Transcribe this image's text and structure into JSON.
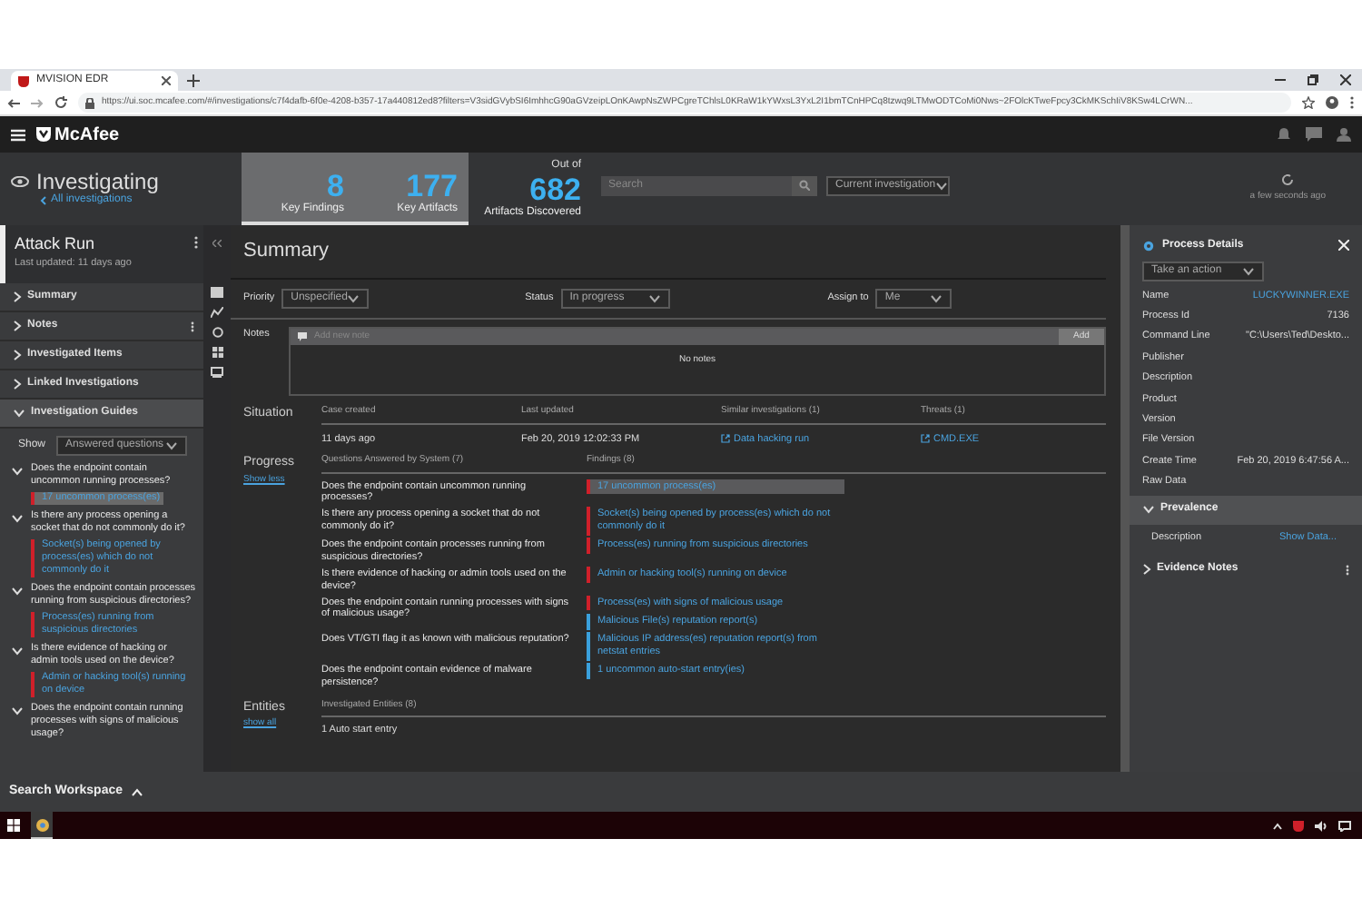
{
  "browser": {
    "tab_title": "MVISION EDR",
    "url": "https://ui.soc.mcafee.com/#/investigations/c7f4dafb-6f0e-4208-b357-17a440812ed8?filters=V3sidGVybSI6ImhhcG90aGVzeipLOnKAwpNsZWPCgreTChlsL0KRaW1kYWxsL3YxL2I1bmTCnHPCq8tzwq9LTMwODTCoMi0Nws~2FOlcKTweFpcy3CkMKSchIiV8KSw4LCrWN..."
  },
  "app": {
    "brand": "McAfee"
  },
  "header": {
    "title": "Investigating",
    "back_link": "All investigations",
    "stats": [
      {
        "value": "8",
        "label": "Key Findings"
      },
      {
        "value": "177",
        "label": "Key Artifacts"
      }
    ],
    "discovered": {
      "caption": "Out of",
      "value": "682",
      "label": "Artifacts Discovered"
    },
    "search": {
      "placeholder": "Search"
    },
    "scope": "Current investigation",
    "refreshed": "a few seconds ago"
  },
  "case": {
    "title": "Attack Run",
    "updated": "Last updated: 11 days ago"
  },
  "sections": [
    {
      "label": "Summary",
      "expanded": false
    },
    {
      "label": "Notes",
      "expanded": false
    },
    {
      "label": "Investigated Items",
      "expanded": false
    },
    {
      "label": "Linked Investigations",
      "expanded": false
    },
    {
      "label": "Investigation Guides",
      "expanded": true
    }
  ],
  "guide_filter": {
    "label": "Show",
    "value": "Answered questions"
  },
  "guides": [
    {
      "question": "Does the endpoint contain uncommon running processes?",
      "expanded": true,
      "finding": "17 uncommon process(es)",
      "selected": true
    },
    {
      "question": "Is there any process opening a socket that do not commonly do it?",
      "expanded": true,
      "finding": "Socket(s) being opened by process(es) which do not commonly do it",
      "selected": false
    },
    {
      "question": "Does the endpoint contain processes running from suspicious directories?",
      "expanded": true,
      "finding": "Process(es) running from suspicious directories",
      "selected": false
    },
    {
      "question": "Is there evidence of hacking or admin tools used on the device?",
      "expanded": true,
      "finding": "Admin or hacking tool(s) running on device",
      "selected": false
    },
    {
      "question": "Does the endpoint contain running processes with signs of malicious usage?",
      "expanded": true
    }
  ],
  "summary": {
    "title": "Summary",
    "fields": [
      {
        "label": "Priority",
        "value": "Unspecified"
      },
      {
        "label": "Status",
        "value": "In progress"
      },
      {
        "label": "Assign to",
        "value": "Me"
      }
    ],
    "notes": {
      "label": "Notes",
      "placeholder": "Add new note",
      "button": "Add",
      "empty": "No notes"
    }
  },
  "situation": {
    "label": "Situation",
    "columns": [
      {
        "heading": "Case created",
        "value": "11 days ago",
        "kind": "text"
      },
      {
        "heading": "Last updated",
        "value": "Feb 20, 2019 12:02:33 PM",
        "kind": "text"
      },
      {
        "heading": "Similar investigations (1)",
        "value": "Data hacking run",
        "kind": "link"
      },
      {
        "heading": "Threats (1)",
        "value": "CMD.EXE",
        "kind": "link"
      }
    ]
  },
  "progress": {
    "label": "Progress",
    "toggle": "Show less",
    "questions_heading": "Questions Answered by System (7)",
    "findings_heading": "Findings (8)",
    "rows": [
      {
        "question": "Does the endpoint contain uncommon running processes?",
        "findings": [
          {
            "text": "17 uncommon process(es)",
            "color": "#d0202a",
            "selected": true
          }
        ]
      },
      {
        "question": "Is there any process opening a socket that do not commonly do it?",
        "findings": [
          {
            "text": "Socket(s) being opened by process(es) which do not commonly do it",
            "color": "#d0202a",
            "selected": false
          }
        ]
      },
      {
        "question": "Does the endpoint contain processes running from suspicious directories?",
        "findings": [
          {
            "text": "Process(es) running from suspicious directories",
            "color": "#d0202a",
            "selected": false
          }
        ]
      },
      {
        "question": "Is there evidence of hacking or admin tools used on the device?",
        "findings": [
          {
            "text": "Admin or hacking tool(s) running on device",
            "color": "#d0202a",
            "selected": false
          }
        ]
      },
      {
        "question": "Does the endpoint contain running processes with signs of malicious usage?",
        "findings": [
          {
            "text": "Process(es) with signs of malicious usage",
            "color": "#d0202a",
            "selected": false
          },
          {
            "text": "Malicious File(s) reputation report(s)",
            "color": "#3aa0dc",
            "selected": false
          }
        ]
      },
      {
        "question": "Does VT/GTI flag it as known with malicious reputation?",
        "findings": [
          {
            "text": "Malicious IP address(es) reputation report(s) from netstat entries",
            "color": "#3aa0dc",
            "selected": false
          }
        ]
      },
      {
        "question": "Does the endpoint contain evidence of malware persistence?",
        "findings": [
          {
            "text": "1 uncommon auto-start entry(ies)",
            "color": "#3aa0dc",
            "selected": false
          }
        ]
      }
    ]
  },
  "entities": {
    "label": "Entities",
    "toggle": "show all",
    "heading": "Investigated Entities (8)",
    "first": "1 Auto start entry"
  },
  "details": {
    "title": "Process Details",
    "action": "Take an action",
    "properties": [
      {
        "label": "Name",
        "value": "LUCKYWINNER.EXE",
        "kind": "link"
      },
      {
        "label": "Process Id",
        "value": "7136",
        "kind": "text"
      },
      {
        "label": "Command Line",
        "value": "\"C:\\Users\\Ted\\Deskto...",
        "kind": "text"
      },
      {
        "label": "Publisher"
      },
      {
        "label": "Description"
      },
      {
        "label": "Product"
      },
      {
        "label": "Version"
      },
      {
        "label": "File Version"
      },
      {
        "label": "Create Time",
        "value": "Feb 20, 2019 6:47:56 A...",
        "kind": "text"
      },
      {
        "label": "Raw Data"
      }
    ],
    "sections": [
      {
        "label": "Prevalence",
        "expanded": true,
        "rows": [
          {
            "label": "Description",
            "value": "Show Data..."
          }
        ]
      },
      {
        "label": "Evidence Notes",
        "expanded": false
      }
    ]
  },
  "footer": {
    "label": "Search Workspace"
  }
}
